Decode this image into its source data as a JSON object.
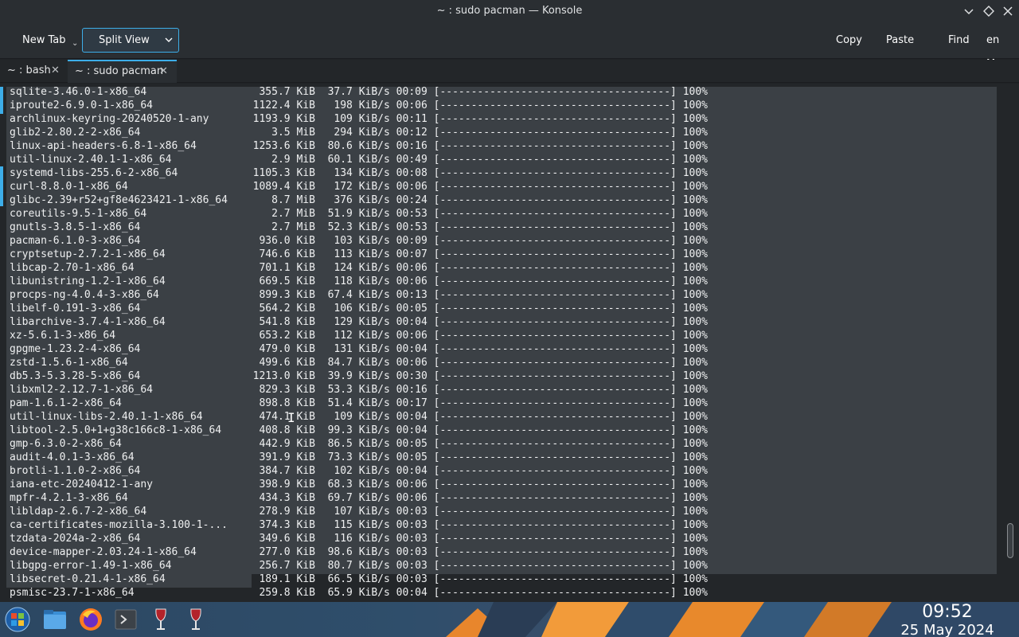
{
  "window": {
    "title": "~ : sudo pacman — Konsole",
    "controls": [
      "chevron-down",
      "diamond",
      "close"
    ]
  },
  "toolbar": {
    "new_tab": "New Tab",
    "split_view": "Split View",
    "copy": "Copy",
    "paste": "Paste",
    "find": "Find",
    "menu_truncated": "en Me"
  },
  "tabs": [
    {
      "label": "~ : bash",
      "active": false
    },
    {
      "label": "~ : sudo pacman",
      "active": true
    }
  ],
  "terminal": {
    "lines": [
      {
        "pkg": "sqlite-3.46.0-1-x86_64",
        "rest": "   355.7 KiB  37.7 KiB/s 00:09 [-------------------------------------] 100%"
      },
      {
        "pkg": "iproute2-6.9.0-1-x86_64",
        "rest": "  1122.4 KiB   198 KiB/s 00:06 [-------------------------------------] 100%"
      },
      {
        "pkg": "archlinux-keyring-20240520-1-any",
        "rest": "  1193.9 KiB   109 KiB/s 00:11 [-------------------------------------] 100%"
      },
      {
        "pkg": "glib2-2.80.2-2-x86_64",
        "rest": "     3.5 MiB   294 KiB/s 00:12 [-------------------------------------] 100%"
      },
      {
        "pkg": "linux-api-headers-6.8-1-x86_64",
        "rest": "  1253.6 KiB  80.6 KiB/s 00:16 [-------------------------------------] 100%"
      },
      {
        "pkg": "util-linux-2.40.1-1-x86_64",
        "rest": "     2.9 MiB  60.1 KiB/s 00:49 [-------------------------------------] 100%"
      },
      {
        "pkg": "systemd-libs-255.6-2-x86_64",
        "rest": "  1105.3 KiB   134 KiB/s 00:08 [-------------------------------------] 100%"
      },
      {
        "pkg": "curl-8.8.0-1-x86_64",
        "rest": "  1089.4 KiB   172 KiB/s 00:06 [-------------------------------------] 100%"
      },
      {
        "pkg": "glibc-2.39+r52+gf8e4623421-1-x86_64",
        "rest": "     8.7 MiB   376 KiB/s 00:24 [-------------------------------------] 100%"
      },
      {
        "pkg": "coreutils-9.5-1-x86_64",
        "rest": "     2.7 MiB  51.9 KiB/s 00:53 [-------------------------------------] 100%"
      },
      {
        "pkg": "gnutls-3.8.5-1-x86_64",
        "rest": "     2.7 MiB  52.3 KiB/s 00:53 [-------------------------------------] 100%"
      },
      {
        "pkg": "pacman-6.1.0-3-x86_64",
        "rest": "   936.0 KiB   103 KiB/s 00:09 [-------------------------------------] 100%"
      },
      {
        "pkg": "cryptsetup-2.7.2-1-x86_64",
        "rest": "   746.6 KiB   113 KiB/s 00:07 [-------------------------------------] 100%"
      },
      {
        "pkg": "libcap-2.70-1-x86_64",
        "rest": "   701.1 KiB   124 KiB/s 00:06 [-------------------------------------] 100%"
      },
      {
        "pkg": "libunistring-1.2-1-x86_64",
        "rest": "   669.5 KiB   118 KiB/s 00:06 [-------------------------------------] 100%"
      },
      {
        "pkg": "procps-ng-4.0.4-3-x86_64",
        "rest": "   899.3 KiB  67.4 KiB/s 00:13 [-------------------------------------] 100%"
      },
      {
        "pkg": "libelf-0.191-3-x86_64",
        "rest": "   564.2 KiB   106 KiB/s 00:05 [-------------------------------------] 100%"
      },
      {
        "pkg": "libarchive-3.7.4-1-x86_64",
        "rest": "   541.8 KiB   129 KiB/s 00:04 [-------------------------------------] 100%"
      },
      {
        "pkg": "xz-5.6.1-3-x86_64",
        "rest": "   653.2 KiB   112 KiB/s 00:06 [-------------------------------------] 100%"
      },
      {
        "pkg": "gpgme-1.23.2-4-x86_64",
        "rest": "   479.0 KiB   131 KiB/s 00:04 [-------------------------------------] 100%"
      },
      {
        "pkg": "zstd-1.5.6-1-x86_64",
        "rest": "   499.6 KiB  84.7 KiB/s 00:06 [-------------------------------------] 100%"
      },
      {
        "pkg": "db5.3-5.3.28-5-x86_64",
        "rest": "  1213.0 KiB  39.9 KiB/s 00:30 [-------------------------------------] 100%"
      },
      {
        "pkg": "libxml2-2.12.7-1-x86_64",
        "rest": "   829.3 KiB  53.3 KiB/s 00:16 [-------------------------------------] 100%"
      },
      {
        "pkg": "pam-1.6.1-2-x86_64",
        "rest": "   898.8 KiB  51.4 KiB/s 00:17 [-------------------------------------] 100%"
      },
      {
        "pkg": "util-linux-libs-2.40.1-1-x86_64",
        "rest": "   474.1 KiB   109 KiB/s 00:04 [-------------------------------------] 100%"
      },
      {
        "pkg": "libtool-2.5.0+1+g38c166c8-1-x86_64",
        "rest": "   408.8 KiB  99.3 KiB/s 00:04 [-------------------------------------] 100%"
      },
      {
        "pkg": "gmp-6.3.0-2-x86_64",
        "rest": "   442.9 KiB  86.5 KiB/s 00:05 [-------------------------------------] 100%"
      },
      {
        "pkg": "audit-4.0.1-3-x86_64",
        "rest": "   391.9 KiB  73.3 KiB/s 00:05 [-------------------------------------] 100%"
      },
      {
        "pkg": "brotli-1.1.0-2-x86_64",
        "rest": "   384.7 KiB   102 KiB/s 00:04 [-------------------------------------] 100%"
      },
      {
        "pkg": "iana-etc-20240412-1-any",
        "rest": "   398.9 KiB  68.3 KiB/s 00:06 [-------------------------------------] 100%"
      },
      {
        "pkg": "mpfr-4.2.1-3-x86_64",
        "rest": "   434.3 KiB  69.7 KiB/s 00:06 [-------------------------------------] 100%"
      },
      {
        "pkg": "libldap-2.6.7-2-x86_64",
        "rest": "   278.9 KiB   107 KiB/s 00:03 [-------------------------------------] 100%"
      },
      {
        "pkg": "ca-certificates-mozilla-3.100-1-...",
        "rest": "   374.3 KiB   115 KiB/s 00:03 [-------------------------------------] 100%"
      },
      {
        "pkg": "tzdata-2024a-2-x86_64",
        "rest": "   349.6 KiB   116 KiB/s 00:03 [-------------------------------------] 100%"
      },
      {
        "pkg": "device-mapper-2.03.24-1-x86_64",
        "rest": "   277.0 KiB  98.6 KiB/s 00:03 [-------------------------------------] 100%"
      },
      {
        "pkg": "libgpg-error-1.49-1-x86_64",
        "rest": "   256.7 KiB  80.7 KiB/s 00:03 [-------------------------------------] 100%"
      },
      {
        "pkg": "libsecret-0.21.4-1-x86_64",
        "rest": "   189.1 KiB  66.5 KiB/s 00:03 [-------------------------------------] 100%"
      },
      {
        "pkg": "psmisc-23.7-1-x86_64",
        "rest": "   259.8 KiB  65.9 KiB/s 00:04 [-------------------------------------] 100%"
      }
    ]
  },
  "taskbar": {
    "icons": [
      "start-menu-icon",
      "file-manager-icon",
      "firefox-icon",
      "konsole-icon",
      "wine-glass-icon",
      "wine-glass-icon"
    ],
    "time": "09:52",
    "date": "25 May 2024"
  },
  "colors": {
    "accent": "#3daee9",
    "terminal_bg": "#232629",
    "selection": "#3b4045"
  }
}
